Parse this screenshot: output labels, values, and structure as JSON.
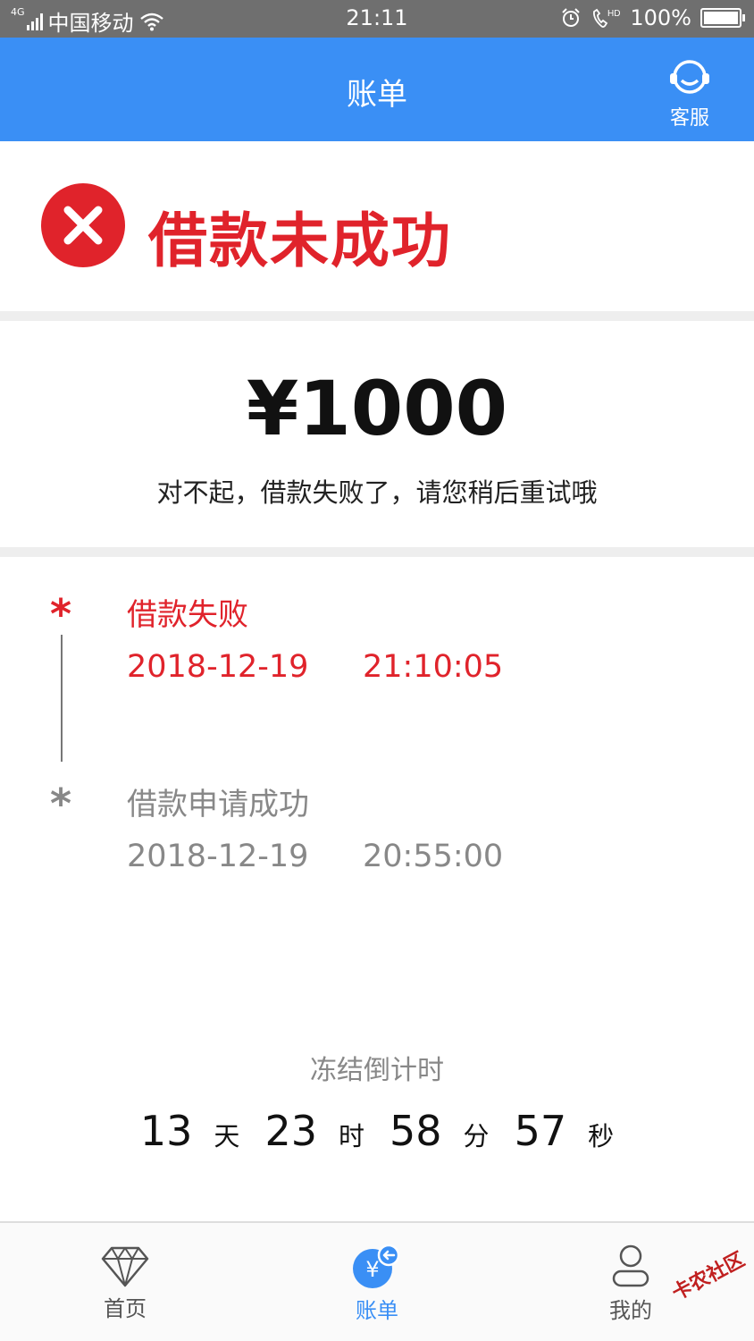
{
  "status_bar": {
    "network_type": "4G",
    "carrier": "中国移动",
    "time": "21:11",
    "battery": "100%"
  },
  "header": {
    "title": "账单",
    "customer_service_label": "客服"
  },
  "result": {
    "status_text": "借款未成功",
    "amount": "¥1000",
    "message": "对不起，借款失败了，请您稍后重试哦"
  },
  "timeline": [
    {
      "marker": "*",
      "title": "借款失败",
      "date": "2018-12-19",
      "time": "21:10:05",
      "color": "#e0232b"
    },
    {
      "marker": "*",
      "title": "借款申请成功",
      "date": "2018-12-19",
      "time": "20:55:00",
      "color": "#888888"
    }
  ],
  "countdown": {
    "title": "冻结倒计时",
    "days": "13",
    "days_unit": "天",
    "hours": "23",
    "hours_unit": "时",
    "minutes": "58",
    "minutes_unit": "分",
    "seconds": "57",
    "seconds_unit": "秒"
  },
  "nav": {
    "items": [
      {
        "label": "首页",
        "icon": "diamond-icon",
        "active": false
      },
      {
        "label": "账单",
        "icon": "bill-yen-icon",
        "active": true
      },
      {
        "label": "我的",
        "icon": "user-icon",
        "active": false
      }
    ]
  },
  "watermark": "卡农社区",
  "colors": {
    "primary": "#3a8ff5",
    "error": "#e0232b",
    "status_bar": "#6f6f6f",
    "muted": "#888888"
  }
}
